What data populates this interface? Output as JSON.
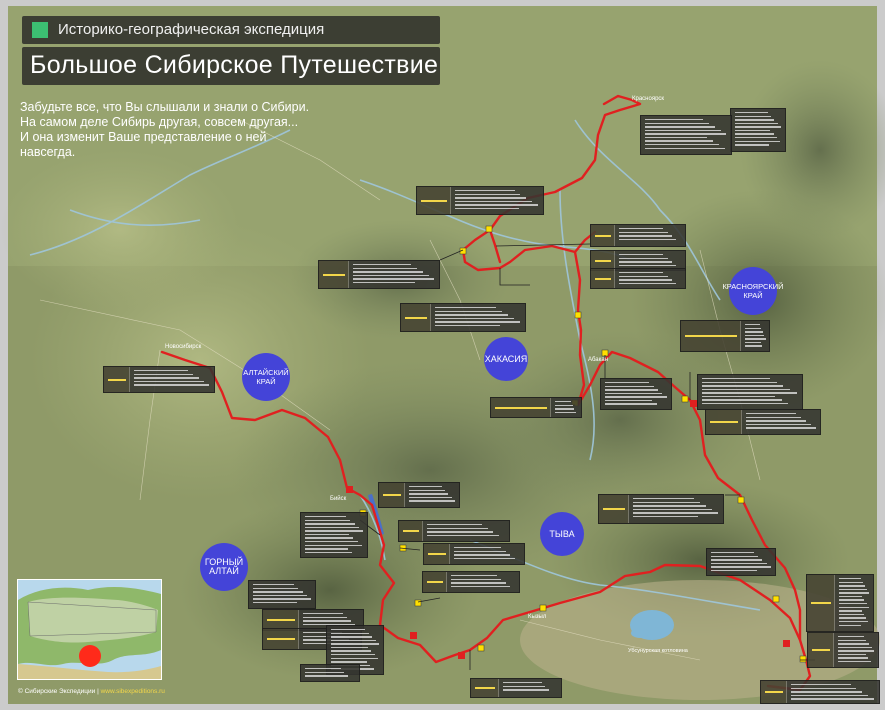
{
  "header": {
    "subtitle": "Историко-географическая экспедиция",
    "title": "Большое Сибирское Путешествие",
    "accent": "#3cbf72"
  },
  "intro": {
    "lines": [
      "Забудьте все, что Вы слышали и знали о Сибири.",
      "На самом деле Сибирь другая, совсем другая...",
      "И она изменит Ваше представление о ней",
      "навсегда."
    ]
  },
  "regions": [
    {
      "label": "АЛТАЙСКИЙ\nКРАЙ"
    },
    {
      "label": "ХАКАСИЯ"
    },
    {
      "label": "КРАСНОЯРСКИЙ\nКРАЙ"
    },
    {
      "label": "ТЫВА"
    },
    {
      "label": "ГОРНЫЙ\nАЛТАЙ"
    }
  ],
  "cities": {
    "novosibirsk": "Новосибирск",
    "krasnoyarsk": "Красноярск",
    "abakan": "Абакан",
    "biysk": "Бийск",
    "kyzyl": "Кызыл"
  },
  "lake_label": "Убсунурская котловина",
  "footer": {
    "copyright": "© Сибирские Экспедиции | ",
    "site": "www.sibexpeditions.ru"
  },
  "colors": {
    "route": "#e02020",
    "region": "#4444d8",
    "stop_name": "#f2d64a",
    "water": "#9fc6dc"
  },
  "map": {
    "style": "terrain",
    "route_color": "#e02020"
  }
}
